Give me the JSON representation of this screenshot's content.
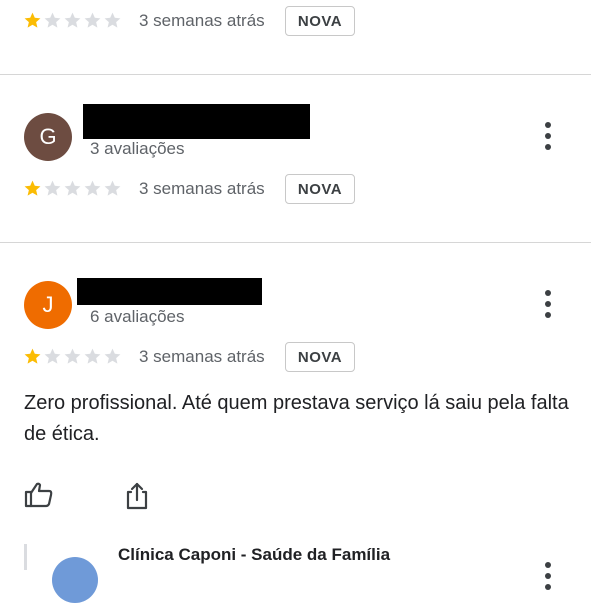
{
  "reviews": [
    {
      "time": "3 semanas atrás",
      "badge": "NOVA",
      "rating": 1
    },
    {
      "avatar_letter": "G",
      "avatar_color": "#6d4c41",
      "review_count": "3 avaliações",
      "time": "3 semanas atrás",
      "badge": "NOVA",
      "rating": 1
    },
    {
      "avatar_letter": "J",
      "avatar_color": "#ef6c00",
      "review_count": "6 avaliações",
      "time": "3 semanas atrás",
      "badge": "NOVA",
      "rating": 1,
      "text": "Zero profissional. Até quem prestava serviço lá saiu pela falta de ética."
    }
  ],
  "owner_response": {
    "name": "Clínica Caponi - Saúde da Família"
  },
  "colors": {
    "star_filled": "#fbbc04",
    "star_empty": "#dadce0"
  },
  "icons": {
    "like": "thumbs-up-icon",
    "share": "share-icon",
    "menu": "more-vert-icon",
    "star": "star-icon"
  }
}
